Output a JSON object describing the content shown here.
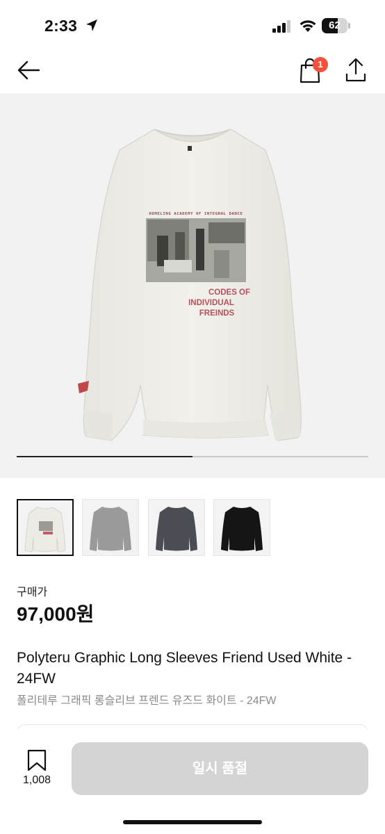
{
  "status_bar": {
    "time": "2:33",
    "battery": "62",
    "battery_level_percent": 62
  },
  "nav": {
    "cart_badge": "1",
    "icons": [
      "arrow-left-icon",
      "shopping-bag-icon",
      "share-icon"
    ]
  },
  "gallery": {
    "shirt_print": {
      "header": "HOMELING ACADEMY OF INTEGRAL DANCE",
      "line1": "CODES OF",
      "line2": "INDIVIDUAL",
      "line3": "FREINDS"
    },
    "progress_fraction": 0.5,
    "thumbnail_colors": [
      "#ecebe6",
      "#9a9a9a",
      "#4b4d55",
      "#151515"
    ]
  },
  "product": {
    "price_label": "구매가",
    "price": "97,000원",
    "title_en": "Polyteru Graphic Long Sleeves Friend Used White - 24FW",
    "title_ko": "폴리테루 그래픽 롱슬리브 프렌드 유즈드 화이트 - 24FW"
  },
  "bottom_bar": {
    "wish_count": "1,008",
    "sold_out_label": "일시 품절"
  },
  "colors": {
    "badge": "#f5503c",
    "disabled_button": "#d4d4d4",
    "hero_background": "#f2f2f2"
  }
}
